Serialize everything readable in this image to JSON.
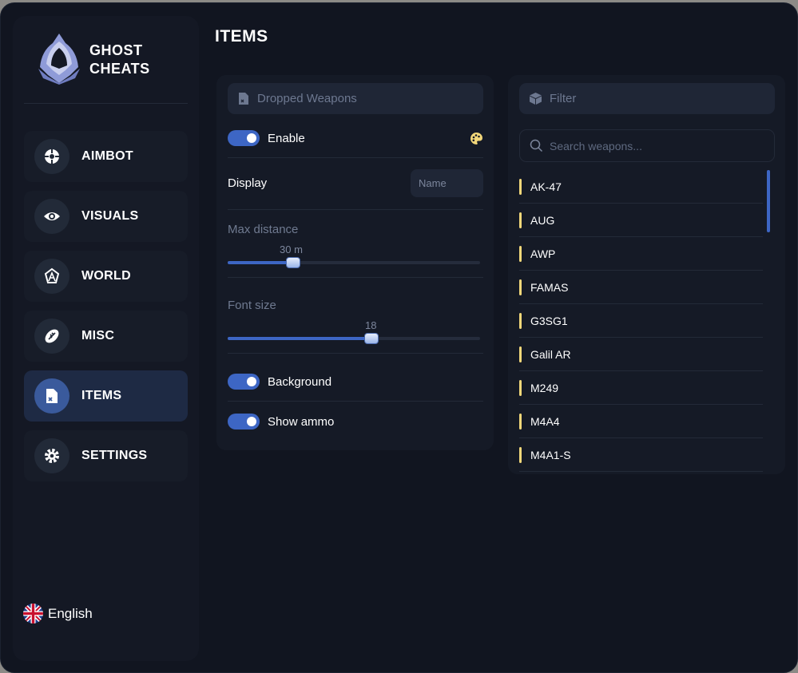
{
  "brand": {
    "line1": "GHOST",
    "line2": "CHEATS"
  },
  "nav": [
    {
      "label": "AIMBOT",
      "icon": "crosshair-icon"
    },
    {
      "label": "VISUALS",
      "icon": "eye-icon"
    },
    {
      "label": "WORLD",
      "icon": "world-icon"
    },
    {
      "label": "MISC",
      "icon": "football-icon"
    },
    {
      "label": "ITEMS",
      "icon": "items-file-icon",
      "active": true
    },
    {
      "label": "SETTINGS",
      "icon": "gear-icon"
    }
  ],
  "language": {
    "label": "English",
    "icon": "uk-flag-icon"
  },
  "page_title": "ITEMS",
  "dropped": {
    "header": "Dropped Weapons",
    "enable_label": "Enable",
    "display_label": "Display",
    "display_value": "Name",
    "max_distance_label": "Max distance",
    "max_distance_value": "30 m",
    "max_distance_fraction": 0.26,
    "font_size_label": "Font size",
    "font_size_value": "18",
    "font_size_fraction": 0.57,
    "background_label": "Background",
    "show_ammo_label": "Show ammo"
  },
  "filter": {
    "header": "Filter",
    "search_placeholder": "Search weapons...",
    "weapons": [
      "AK-47",
      "AUG",
      "AWP",
      "FAMAS",
      "G3SG1",
      "Galil AR",
      "M249",
      "M4A4",
      "M4A1-S"
    ]
  },
  "colors": {
    "accent": "#3d66c4",
    "weapon_marker": "#f2d77a",
    "palette_icon": "#f2d77a"
  }
}
